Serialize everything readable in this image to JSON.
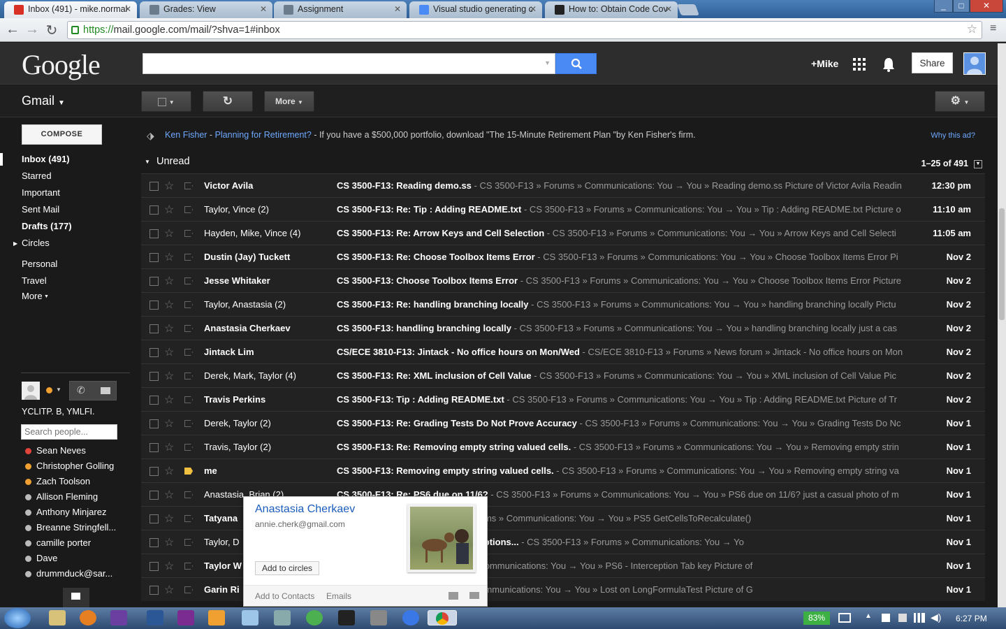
{
  "browser": {
    "tabs": [
      {
        "title": "Inbox (491) - mike.normal",
        "icon": "gmail-icon",
        "icon_color": "#d93025",
        "active": true
      },
      {
        "title": "Grades: View",
        "icon": "canvas-icon",
        "icon_color": "#6b7d8c"
      },
      {
        "title": "Assignment",
        "icon": "canvas-icon",
        "icon_color": "#6b7d8c"
      },
      {
        "title": "Visual studio generating c",
        "icon": "google-icon",
        "icon_color": "#4a8af4"
      },
      {
        "title": "How to: Obtain Code Cov",
        "icon": "msdn-icon",
        "icon_color": "#222222"
      }
    ],
    "url_scheme": "https://",
    "url_rest": "mail.google.com/mail/?shva=1#inbox"
  },
  "header": {
    "logo": "Google",
    "user": "+Mike",
    "share_label": "Share"
  },
  "gmail_bar": {
    "app_label": "Gmail",
    "more_label": "More"
  },
  "sidebar": {
    "compose_label": "COMPOSE",
    "nav": [
      {
        "label": "Inbox (491)",
        "bold": true
      },
      {
        "label": "Starred",
        "bold": false
      },
      {
        "label": "Important",
        "bold": false
      },
      {
        "label": "Sent Mail",
        "bold": false
      },
      {
        "label": "Drafts (177)",
        "bold": true
      },
      {
        "label": "Circles",
        "bold": false
      },
      {
        "label": "Personal",
        "bold": false
      },
      {
        "label": "Travel",
        "bold": false
      },
      {
        "label": "More",
        "bold": false
      }
    ],
    "chat_status": "YCLITP. B, YMLFI.",
    "search_people_placeholder": "Search people...",
    "contacts": [
      {
        "name": "Sean Neves",
        "status_color": "#e0443b"
      },
      {
        "name": "Christopher Golling",
        "status_color": "#f0a030"
      },
      {
        "name": "Zach Toolson",
        "status_color": "#f0a030"
      },
      {
        "name": "Allison Fleming",
        "status_color": "#bbbbbb"
      },
      {
        "name": "Anthony Minjarez",
        "status_color": "#bbbbbb"
      },
      {
        "name": "Breanne Stringfell...",
        "status_color": "#bbbbbb"
      },
      {
        "name": "camille porter",
        "status_color": "#bbbbbb"
      },
      {
        "name": "Dave",
        "status_color": "#bbbbbb"
      },
      {
        "name": "drummduck@sar...",
        "status_color": "#bbbbbb"
      }
    ]
  },
  "ad": {
    "sponsor": "Ken Fisher",
    "sep": " - ",
    "headline": "Planning for Retirement?",
    "body": " - If you have a $500,000 portfolio, download \"The 15-Minute Retirement Plan \"by Ken Fisher's firm.",
    "why": "Why this ad?"
  },
  "list": {
    "section": "Unread",
    "pagination": "1–25 of 491",
    "rows": [
      {
        "from": "Victor Avila",
        "subject": "CS 3500-F13: Reading demo.ss",
        "snippet": " - CS 3500-F13 » Forums » Communications: You → You » Reading demo.ss Picture of Victor Avila Readin",
        "date": "12:30 pm",
        "unread": true,
        "important": false
      },
      {
        "from": "Taylor, Vince (2)",
        "subject": "CS 3500-F13: Re: Tip : Adding README.txt",
        "snippet": " - CS 3500-F13 » Forums » Communications: You → You » Tip : Adding README.txt Picture o",
        "date": "11:10 am",
        "unread": false,
        "important": false
      },
      {
        "from": "Hayden, Mike, Vince (4)",
        "subject": "CS 3500-F13: Re: Arrow Keys and Cell Selection",
        "snippet": " - CS 3500-F13 » Forums » Communications: You → You » Arrow Keys and Cell Selecti",
        "date": "11:05 am",
        "unread": false,
        "important": false
      },
      {
        "from": "Dustin (Jay) Tuckett",
        "subject": "CS 3500-F13: Re: Choose Toolbox Items Error",
        "snippet": " - CS 3500-F13 » Forums » Communications: You → You » Choose Toolbox Items Error Pi",
        "date": "Nov 2",
        "unread": true,
        "important": false
      },
      {
        "from": "Jesse Whitaker",
        "subject": "CS 3500-F13: Choose Toolbox Items Error",
        "snippet": " - CS 3500-F13 » Forums » Communications: You → You » Choose Toolbox Items Error Picture",
        "date": "Nov 2",
        "unread": true,
        "important": false
      },
      {
        "from": "Taylor, Anastasia (2)",
        "subject": "CS 3500-F13: Re: handling branching locally",
        "snippet": " - CS 3500-F13 » Forums » Communications: You → You » handling branching locally Pictu",
        "date": "Nov 2",
        "unread": false,
        "important": false
      },
      {
        "from": "Anastasia Cherkaev",
        "subject": "CS 3500-F13: handling branching locally",
        "snippet": " - CS 3500-F13 » Forums » Communications: You → You » handling branching locally just a cas",
        "date": "Nov 2",
        "unread": true,
        "important": false
      },
      {
        "from": "Jintack Lim",
        "subject": "CS/ECE 3810-F13: Jintack - No office hours on Mon/Wed",
        "snippet": " - CS/ECE 3810-F13 » Forums » News forum » Jintack - No office hours on Mon",
        "date": "Nov 2",
        "unread": true,
        "important": false
      },
      {
        "from": "Derek, Mark, Taylor (4)",
        "subject": "CS 3500-F13: Re: XML inclusion of Cell Value",
        "snippet": " - CS 3500-F13 » Forums » Communications: You → You » XML inclusion of Cell Value Pic",
        "date": "Nov 2",
        "unread": false,
        "important": false
      },
      {
        "from": "Travis Perkins",
        "subject": "CS 3500-F13: Tip : Adding README.txt",
        "snippet": " - CS 3500-F13 » Forums » Communications: You → You » Tip : Adding README.txt Picture of Tr",
        "date": "Nov 2",
        "unread": true,
        "important": false
      },
      {
        "from": "Derek, Taylor (2)",
        "subject": "CS 3500-F13: Re: Grading Tests Do Not Prove Accuracy",
        "snippet": " - CS 3500-F13 » Forums » Communications: You → You » Grading Tests Do Nc",
        "date": "Nov 1",
        "unread": false,
        "important": false
      },
      {
        "from": "Travis, Taylor (2)",
        "subject": "CS 3500-F13: Re: Removing empty string valued cells.",
        "snippet": " - CS 3500-F13 » Forums » Communications: You → You » Removing empty strin",
        "date": "Nov 1",
        "unread": false,
        "important": false
      },
      {
        "from": "me",
        "subject": "CS 3500-F13: Removing empty string valued cells.",
        "snippet": " - CS 3500-F13 » Forums » Communications: You → You » Removing empty string va",
        "date": "Nov 1",
        "unread": true,
        "important": true
      },
      {
        "from": "Anastasia, Brian (2)",
        "subject": "CS 3500-F13: Re: PS6 due on 11/6?",
        "snippet": " - CS 3500-F13 » Forums » Communications: You → You » PS6 due on 11/6? just a casual photo of m",
        "date": "Nov 1",
        "unread": false,
        "important": false
      },
      {
        "from": "Tatyana",
        "subject": "Recalculate()",
        "snippet": " - CS 3500-F13 » Forums » Communications: You → You » PS5 GetCellsToRecalculate()",
        "date": "Nov 1",
        "unread": true,
        "important": false
      },
      {
        "from": "Taylor, D",
        "subject": "ediumSavea, NormalizeTest4 exceptions...",
        "snippet": " - CS 3500-F13 » Forums » Communications: You → Yo",
        "date": "Nov 1",
        "unread": false,
        "important": false
      },
      {
        "from": "Taylor W",
        "subject": "ab key",
        "snippet": " - CS 3500-F13 » Forums » Communications: You → You » PS6 - Interception Tab key Picture of",
        "date": "Nov 1",
        "unread": true,
        "important": false
      },
      {
        "from": "Garin Ri",
        "subject": "aTest",
        "snippet": " - CS 3500-F13 » Forums » Communications: You → You » Lost on LongFormulaTest Picture of G",
        "date": "Nov 1",
        "unread": true,
        "important": false
      }
    ]
  },
  "hover_card": {
    "name": "Anastasia Cherkaev",
    "email": "annie.cherk@gmail.com",
    "add_circles": "Add to circles",
    "add_contacts": "Add to Contacts",
    "emails": "Emails"
  },
  "taskbar": {
    "battery": "83%",
    "time": "6:27 PM"
  }
}
